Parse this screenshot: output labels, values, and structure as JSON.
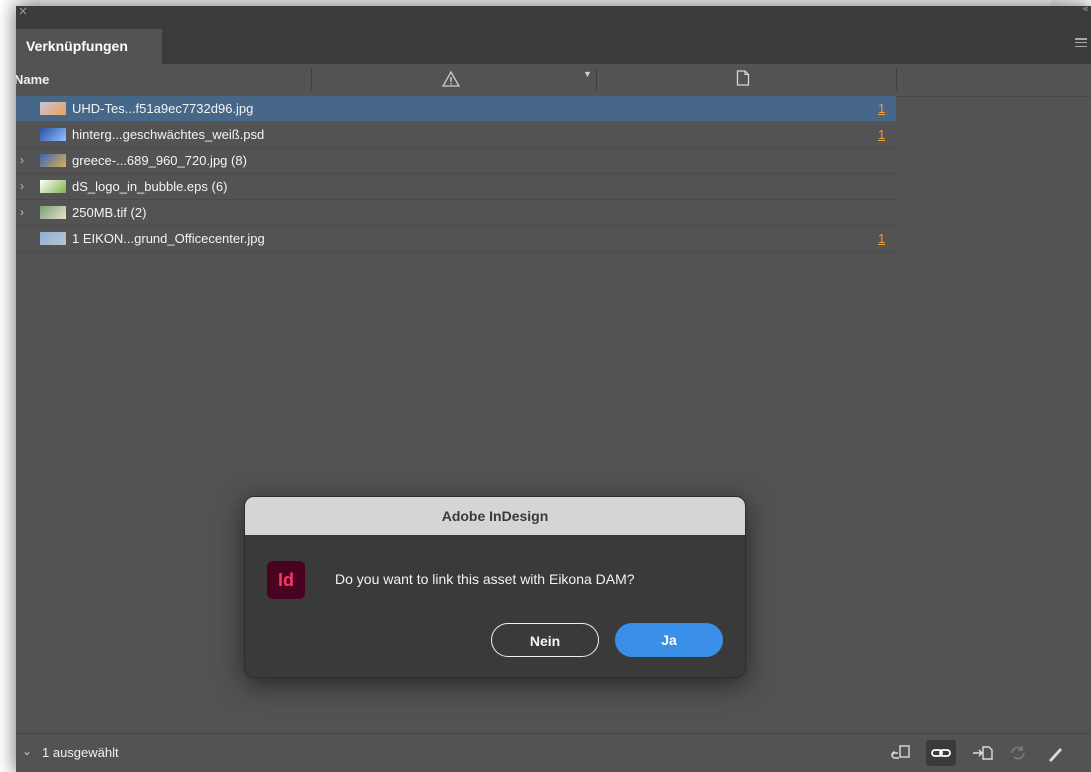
{
  "panel": {
    "close_glyph": "×",
    "collapse_glyph": "‹‹",
    "tab_label": "Verknüpfungen",
    "menu_icon": "hamburger-menu-icon"
  },
  "columns": {
    "name": "Name",
    "status_icon": "warning-triangle-icon",
    "sort_icon": "sort-down-icon",
    "page_icon": "page-icon"
  },
  "links": [
    {
      "name": "UHD-Tes...f51a9ec7732d96.jpg",
      "page": "1",
      "expandable": false,
      "selected": true,
      "thumb_colors": [
        "#c9c3d8",
        "#e9a35a"
      ]
    },
    {
      "name": "hinterg...geschwächtes_weiß.psd",
      "page": "1",
      "expandable": false,
      "selected": false,
      "thumb_colors": [
        "#2b4fa3",
        "#8fc4ff"
      ]
    },
    {
      "name": "greece-...689_960_720.jpg (8)",
      "page": "",
      "expandable": true,
      "selected": false,
      "thumb_colors": [
        "#3b64b4",
        "#d8b058"
      ]
    },
    {
      "name": "dS_logo_in_bubble.eps (6)",
      "page": "",
      "expandable": true,
      "selected": false,
      "thumb_colors": [
        "#ffffff",
        "#7fb24a"
      ]
    },
    {
      "name": "250MB.tif (2)",
      "page": "",
      "expandable": true,
      "selected": false,
      "thumb_colors": [
        "#7aa07a",
        "#e8e0c8"
      ]
    },
    {
      "name": "1 EIKON...grund_Officecenter.jpg",
      "page": "1",
      "expandable": false,
      "selected": false,
      "thumb_colors": [
        "#8fb0d8",
        "#b8c4d0"
      ]
    }
  ],
  "footer": {
    "selection_text": "1 ausgewählt",
    "icons": [
      "relink-cc-library-icon",
      "link-icon",
      "goto-link-icon",
      "update-link-icon",
      "edit-original-icon"
    ]
  },
  "dialog": {
    "title": "Adobe InDesign",
    "app_icon_text": "Id",
    "message": "Do you want to link this asset with Eikona DAM?",
    "no_label": "Nein",
    "yes_label": "Ja"
  },
  "colors": {
    "selection": "#466787",
    "page_link": "#f0a03c",
    "primary_button": "#3a8fe8",
    "indesign_icon_bg": "#49021f",
    "indesign_icon_fg": "#ff3366"
  }
}
